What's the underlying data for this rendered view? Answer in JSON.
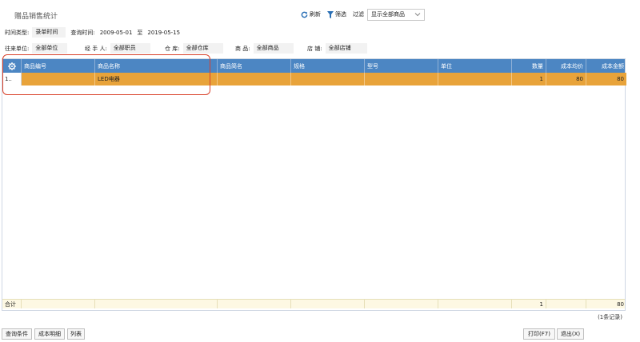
{
  "title": "赠品销售统计",
  "toolbar": {
    "refresh_label": "刷新",
    "filter_label": "筛选",
    "filter_text": "过滤",
    "filter_select": "显示全部商品"
  },
  "query": {
    "time_type_label": "时间类型:",
    "time_type_value": "录单时间",
    "query_time_label": "查询时间:",
    "date_from": "2009-05-01",
    "date_to_word": "至",
    "date_to": "2019-05-15"
  },
  "filters": {
    "partner_label": "往来单位:",
    "partner_value": "全部单位",
    "handler_label": "经 手 人:",
    "handler_value": "全部职员",
    "warehouse_label": "仓  库:",
    "warehouse_value": "全部仓库",
    "goods_label": "商  品:",
    "goods_value": "全部商品",
    "store_label": "店  铺:",
    "store_value": "全部店铺"
  },
  "table": {
    "columns": [
      "商品编号",
      "商品名称",
      "商品简名",
      "规格",
      "型号",
      "单位",
      "数量",
      "成本均价",
      "成本金额"
    ],
    "rows": [
      {
        "index": "1..",
        "code": "",
        "name": "LED电器",
        "short_name": "",
        "spec": "",
        "model": "",
        "unit": "",
        "qty": "1",
        "avg_cost": "80",
        "cost_amount": "80"
      }
    ],
    "footer": {
      "label": "合计",
      "qty": "1",
      "cost_amount": "80"
    }
  },
  "record_count": "(1条记录)",
  "bottom": {
    "query_cond": "查询条件",
    "cost_detail": "成本明细",
    "list": "列表",
    "print": "打印(F7)",
    "exit": "退出(X)"
  },
  "colors": {
    "header_bg": "#4c86c3",
    "selected_row": "#e8a33a",
    "highlight_box": "#d9412a",
    "footer_bg": "#fdf8e3"
  }
}
